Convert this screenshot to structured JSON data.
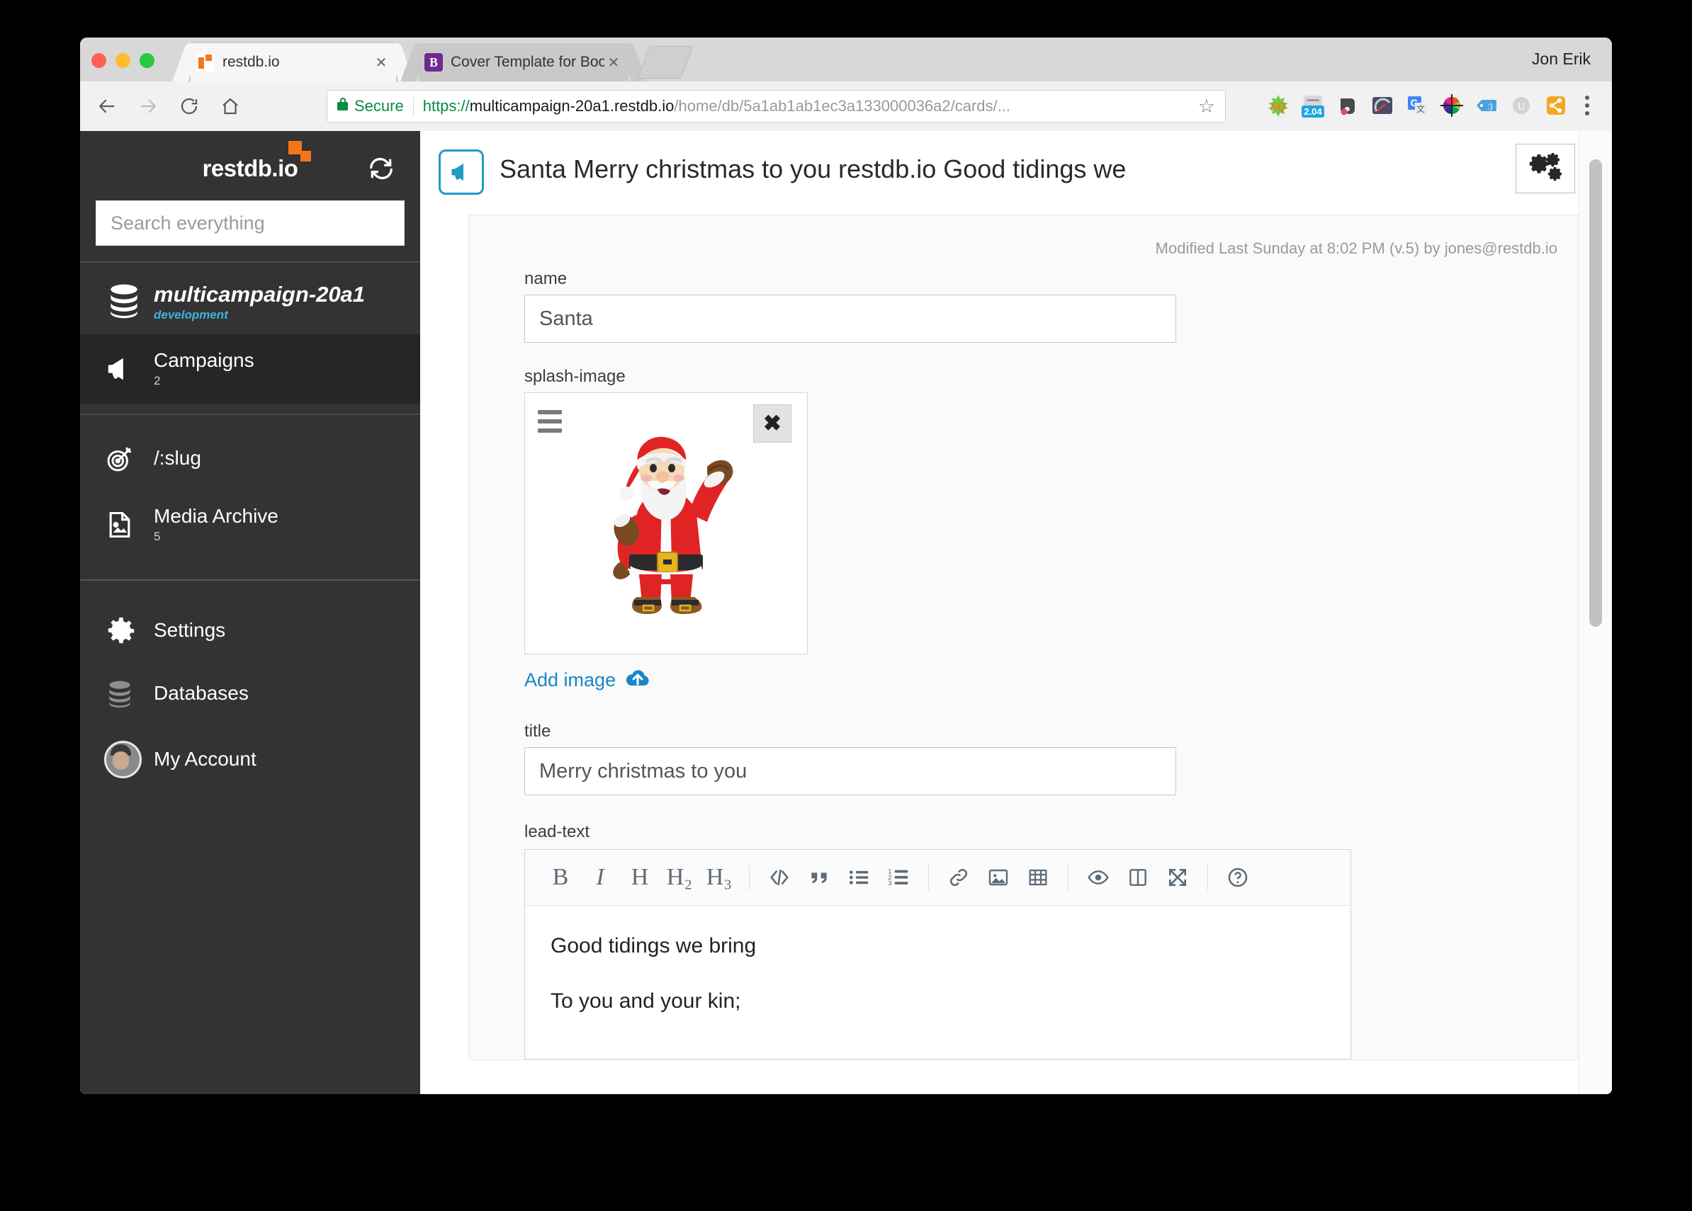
{
  "browser": {
    "window_user": "Jon Erik",
    "tabs": [
      {
        "title": "restdb.io",
        "favicon": "restdb-favicon",
        "active": true,
        "close_label": "✕"
      },
      {
        "title": "Cover Template for Bootstrap",
        "favicon": "bootstrap-favicon",
        "active": false,
        "close_label": "✕"
      }
    ],
    "new_tab_label": "",
    "omnibox": {
      "security_label": "Secure",
      "url_scheme": "https://",
      "url_host": "multicampaign-20a1.restdb.io",
      "url_path": "/home/db/5a1ab1ab1ec3a133000036a2/cards/...",
      "bookmark_icon": "☆"
    },
    "extensions": [
      {
        "name": "sq-icon",
        "glyph": "SQ"
      },
      {
        "name": "badge-204-icon",
        "glyph": "2.04"
      },
      {
        "name": "evernote-icon",
        "glyph": ""
      },
      {
        "name": "speedometer-icon",
        "glyph": ""
      },
      {
        "name": "google-translate-icon",
        "glyph": "G"
      },
      {
        "name": "color-wheel-icon",
        "glyph": ""
      },
      {
        "name": "tag-smiley-icon",
        "glyph": ":)"
      },
      {
        "name": "u-circle-icon",
        "glyph": "U"
      },
      {
        "name": "share-nodes-icon",
        "glyph": ""
      }
    ]
  },
  "sidebar": {
    "logo_text": "restdb.io",
    "search_placeholder": "Search everything",
    "search_value": "",
    "database": {
      "name": "multicampaign-20a1",
      "env": "development"
    },
    "collections": [
      {
        "label": "Campaigns",
        "count": "2",
        "icon": "megaphone-icon",
        "selected": true
      }
    ],
    "pages": [
      {
        "label": "/:slug",
        "count": "",
        "icon": "target-icon"
      },
      {
        "label": "Media Archive",
        "count": "5",
        "icon": "image-file-icon"
      }
    ],
    "bottom": [
      {
        "label": "Settings",
        "icon": "gear-icon"
      },
      {
        "label": "Databases",
        "icon": "database-icon"
      },
      {
        "label": "My Account",
        "icon": "avatar-icon"
      }
    ]
  },
  "main": {
    "header_title": "Santa Merry christmas to you restdb.io Good tidings we",
    "header_icon": "megaphone-icon",
    "settings_icon": "gears-icon",
    "modified": "Modified Last Sunday at 8:02 PM (v.5) by jones@restdb.io",
    "fields": {
      "name": {
        "label": "name",
        "value": "Santa"
      },
      "splash_image": {
        "label": "splash-image",
        "drag_handle_icon": "hamburger-handle-icon",
        "remove_label": "✖",
        "add_label": "Add image",
        "add_icon": "cloud-upload-icon"
      },
      "title": {
        "label": "title",
        "value": "Merry christmas to you"
      },
      "lead_text": {
        "label": "lead-text",
        "lines": [
          "Good tidings we bring",
          "To you and your kin;"
        ]
      }
    },
    "editor_toolbar": [
      {
        "name": "bold-button",
        "glyph": "B",
        "style": "serif"
      },
      {
        "name": "italic-button",
        "glyph": "I",
        "style": "serif-italic"
      },
      {
        "name": "heading-1-button",
        "glyph": "H",
        "style": "serif"
      },
      {
        "name": "heading-2-button",
        "glyph": "H₂",
        "style": "serif"
      },
      {
        "name": "heading-3-button",
        "glyph": "H₃",
        "style": "serif"
      },
      {
        "name": "code-button",
        "glyph": "‹/›",
        "style": "icon"
      },
      {
        "name": "quote-button",
        "glyph": "“",
        "style": "icon"
      },
      {
        "name": "bullet-list-button",
        "glyph": "",
        "style": "icon"
      },
      {
        "name": "numbered-list-button",
        "glyph": "",
        "style": "icon"
      },
      {
        "name": "link-button",
        "glyph": "",
        "style": "icon"
      },
      {
        "name": "insert-image-button",
        "glyph": "",
        "style": "icon"
      },
      {
        "name": "insert-table-button",
        "glyph": "",
        "style": "icon"
      },
      {
        "name": "preview-button",
        "glyph": "",
        "style": "icon"
      },
      {
        "name": "side-by-side-button",
        "glyph": "",
        "style": "icon"
      },
      {
        "name": "fullscreen-button",
        "glyph": "",
        "style": "icon"
      },
      {
        "name": "help-button",
        "glyph": "?",
        "style": "icon"
      }
    ],
    "colors": {
      "accent": "#1a86c8",
      "sidebar_bg": "#333333",
      "env_blue": "#3cb4e0",
      "logo_orange": "#f4761b",
      "secure_green": "#0a8a43"
    }
  }
}
